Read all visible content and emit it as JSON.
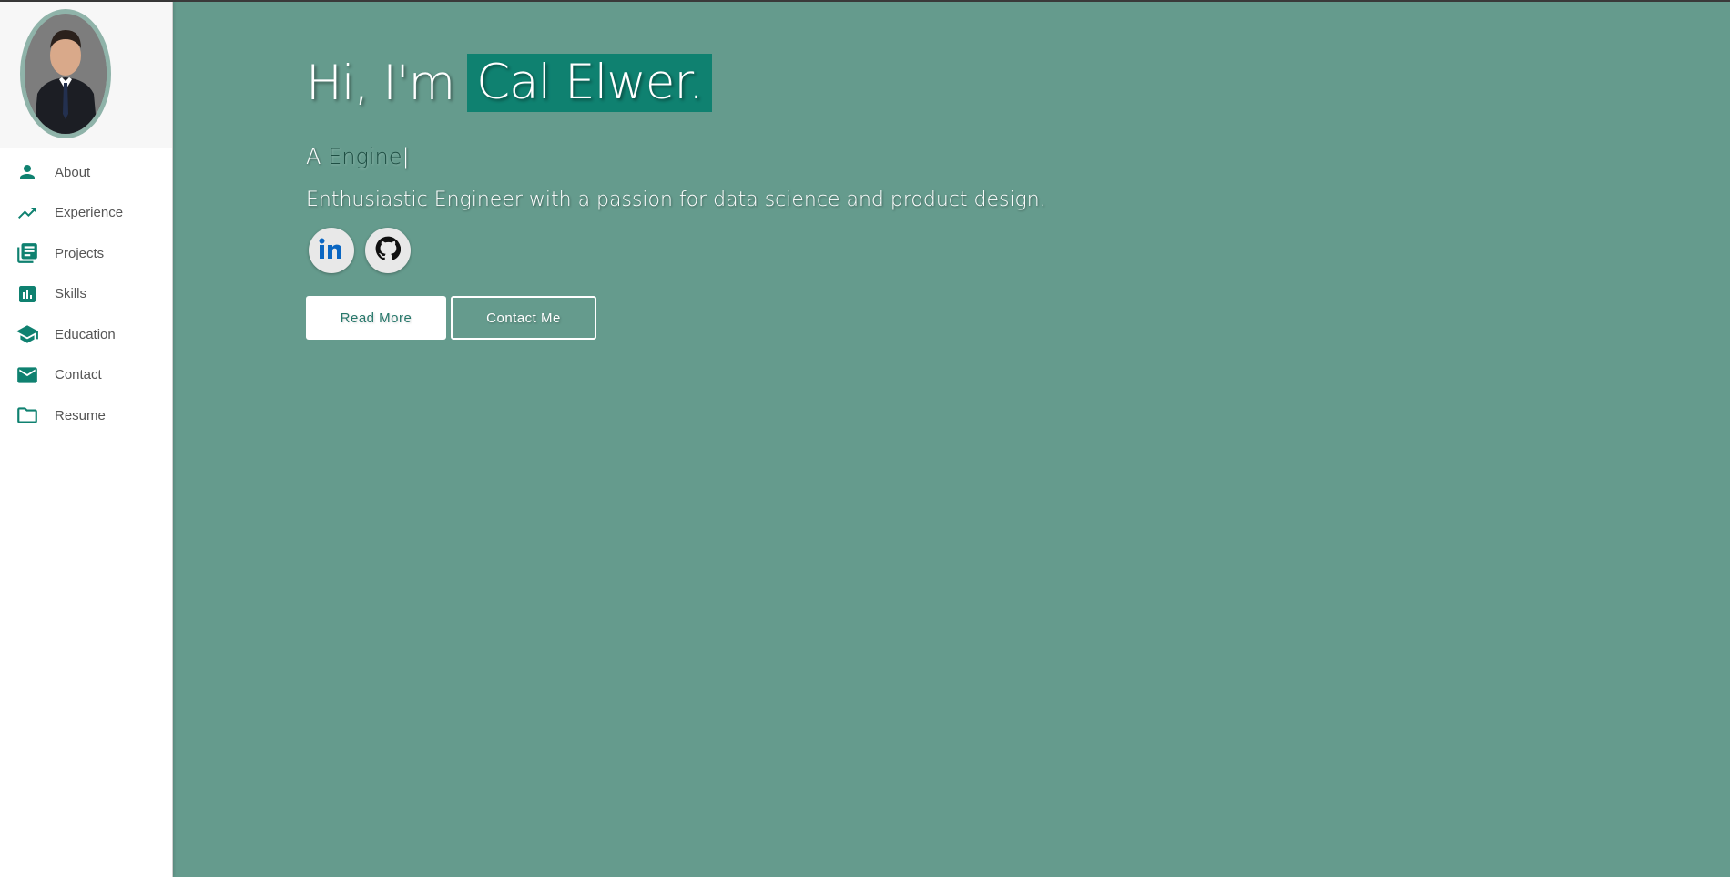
{
  "sidebar": {
    "items": [
      {
        "label": "About",
        "icon": "person-icon"
      },
      {
        "label": "Experience",
        "icon": "trending-up-icon"
      },
      {
        "label": "Projects",
        "icon": "library-books-icon"
      },
      {
        "label": "Skills",
        "icon": "bar-chart-icon"
      },
      {
        "label": "Education",
        "icon": "school-icon"
      },
      {
        "label": "Contact",
        "icon": "mail-icon"
      },
      {
        "label": "Resume",
        "icon": "folder-icon"
      }
    ]
  },
  "hero": {
    "greeting_prefix": "Hi, I'm",
    "name": "Cal Elwer.",
    "tagline_prefix": "A",
    "tagline_role": "Engine",
    "tagline_cursor": "|",
    "bio": "Enthusiastic Engineer with a passion for data science and product design.",
    "socials": [
      {
        "icon": "linkedin-icon"
      },
      {
        "icon": "github-icon"
      }
    ],
    "read_more_label": "Read More",
    "contact_label": "Contact Me"
  },
  "colors": {
    "background": "#659b8d",
    "accent": "#0f8170",
    "sidebar_bg": "#ffffff",
    "icon": "#0f8170"
  }
}
